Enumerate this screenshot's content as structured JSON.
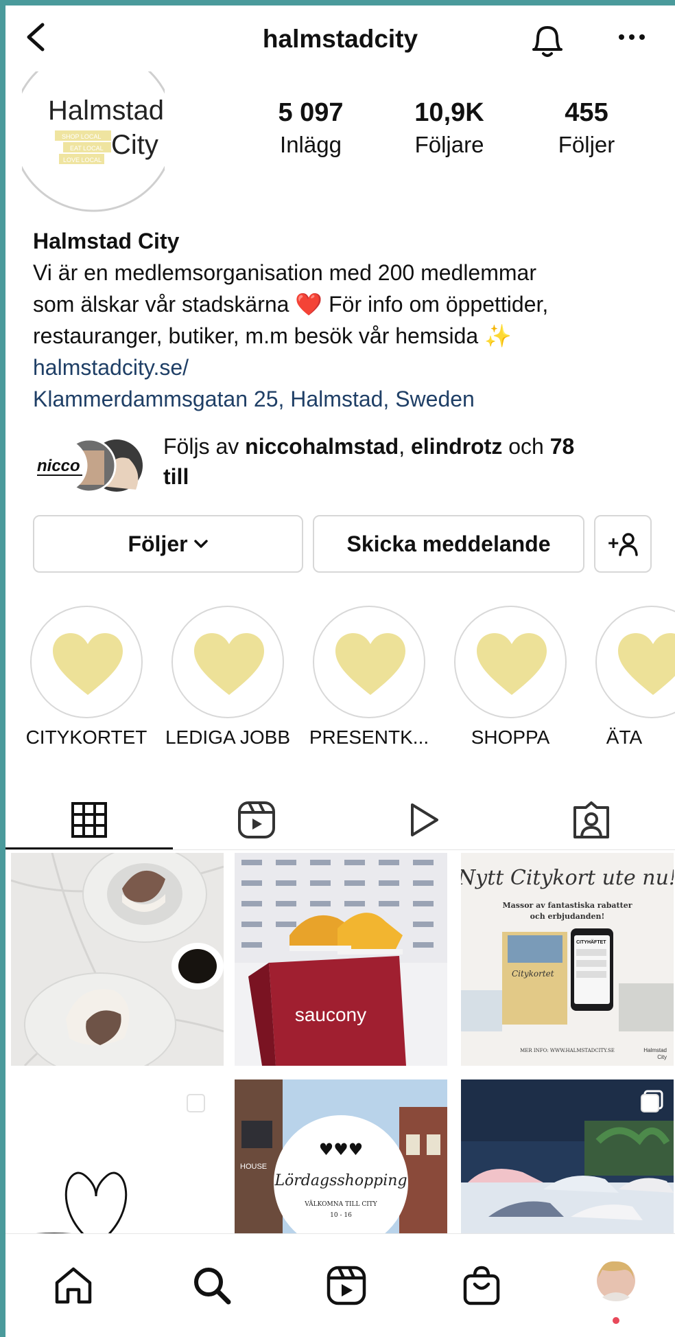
{
  "header": {
    "username": "halmstadcity"
  },
  "avatar": {
    "line1": "Halmstad",
    "line2": "City",
    "tags": [
      "SHOP LOCAL",
      "EAT LOCAL",
      "LOVE LOCAL"
    ]
  },
  "stats": [
    {
      "value": "5 097",
      "label": "Inlägg"
    },
    {
      "value": "10,9K",
      "label": "Följare"
    },
    {
      "value": "455",
      "label": "Följer"
    }
  ],
  "bio": {
    "name": "Halmstad City",
    "line1": "Vi är en medlemsorganisation med 200 medlemmar",
    "line2a": "som älskar vår stadskärna ",
    "line2b": " För info om öppettider,",
    "line3a": "restauranger, butiker, m.m besök vår hemsida ",
    "heart_emoji": "❤️",
    "sparkles_emoji": "✨",
    "website": "halmstadcity.se/",
    "address": "Klammerdammsgatan 25, Halmstad, Sweden"
  },
  "followed_by": {
    "prefix": "Följs av ",
    "user1": "niccohalmstad",
    "sep": ", ",
    "user2": "elindrotz",
    "mid": " och ",
    "count": "78",
    "suffix": "till",
    "logo_text": "nicco"
  },
  "buttons": {
    "following": "Följer",
    "message": "Skicka meddelande",
    "add_user_glyph": "+"
  },
  "highlights": [
    "CITYKORTET",
    "LEDIGA JOBB",
    "PRESENTK...",
    "SHOPPA",
    "ÄTA"
  ],
  "posts": {
    "saucony_text": "saucony",
    "citykort_title": "Nytt Citykort ute nu!",
    "citykort_sub1": "Massor av fantastiska rabatter",
    "citykort_sub2": "och erbjudanden!",
    "citykort_card": "Citykortet",
    "citykort_phone": "CITYHÄFTET",
    "citykort_footer": "MER INFO: WWW.HALMSTADCITY.SE",
    "citykort_brand1": "Halmstad",
    "citykort_brand2": "City",
    "lordags_hearts": "♥♥♥",
    "lordags_title": "Lördagsshopping",
    "lordags_sub": "VÄLKOMNA TILL CITY",
    "lordags_time": "10 - 16",
    "house_sign": "HOUSE"
  },
  "colors": {
    "accent_yellow": "#ede198",
    "link": "#1f3f66",
    "border": "#4a9a9b",
    "notification_dot": "#e8495a"
  }
}
